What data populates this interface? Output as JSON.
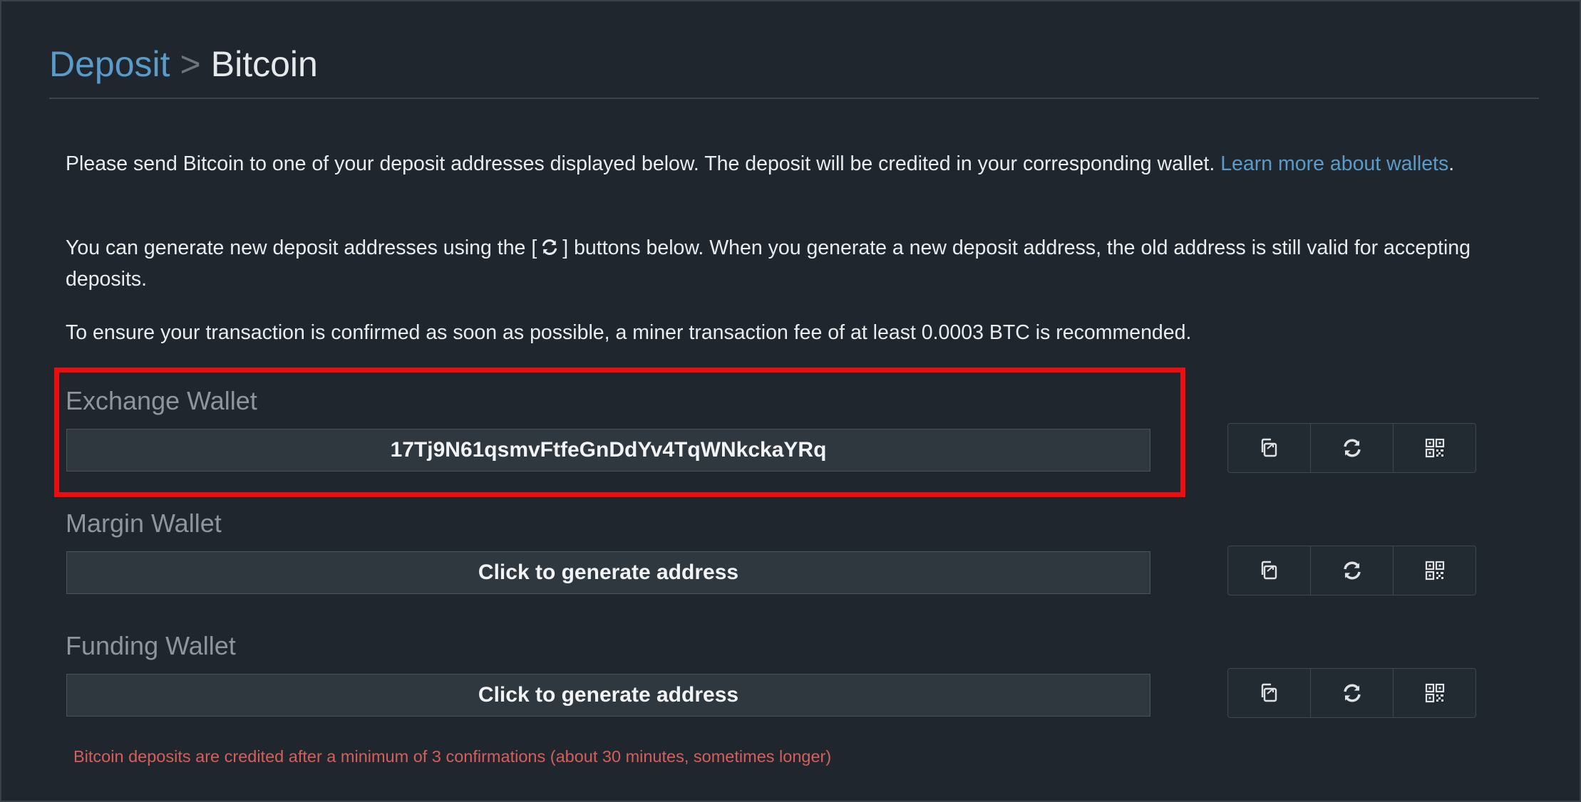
{
  "breadcrumb": {
    "parent": "Deposit",
    "separator": ">",
    "current": "Bitcoin"
  },
  "intro": {
    "p1_text": "Please send Bitcoin to one of your deposit addresses displayed below. The deposit will be credited in your corresponding wallet.",
    "p1_link": "Learn more about wallets",
    "p1_end": ".",
    "p2_before": "You can generate new deposit addresses using the [",
    "p2_after": "] buttons below. When you generate a new deposit address, the old address is still valid for accepting deposits.",
    "p3_text": "To ensure your transaction is confirmed as soon as possible, a miner transaction fee of at least 0.0003 BTC is recommended."
  },
  "wallets": [
    {
      "label": "Exchange Wallet",
      "address": "17Tj9N61qsmvFtfeGnDdYv4TqWNkckaYRq"
    },
    {
      "label": "Margin Wallet",
      "address": "Click to generate address"
    },
    {
      "label": "Funding Wallet",
      "address": "Click to generate address"
    }
  ],
  "icons": {
    "copy": "copy-icon",
    "refresh": "refresh-icon",
    "qr": "qr-code-icon"
  },
  "note": "Bitcoin deposits are credited after a minimum of 3 confirmations (about 30 minutes, sometimes longer)",
  "colors": {
    "background": "#1f262d",
    "link": "#5a9bc9",
    "highlight": "#ec0e0e",
    "note": "#d45f5b"
  }
}
